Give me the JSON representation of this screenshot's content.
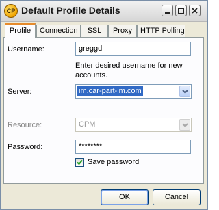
{
  "window": {
    "title": "Default Profile Details",
    "app_icon_text": "CP"
  },
  "tabs": [
    {
      "label": "Profile",
      "active": true
    },
    {
      "label": "Connection",
      "active": false
    },
    {
      "label": "SSL",
      "active": false
    },
    {
      "label": "Proxy",
      "active": false
    },
    {
      "label": "HTTP Polling",
      "active": false
    }
  ],
  "form": {
    "username_label": "Username:",
    "username_value": "greggd",
    "username_hint_line1": "Enter desired username for new",
    "username_hint_line2": "accounts.",
    "server_label": "Server:",
    "server_value": "im.car-part-im.com",
    "resource_label": "Resource:",
    "resource_value": "CPM",
    "password_label": "Password:",
    "password_value": "********",
    "save_password_label": "Save password",
    "save_password_checked": true
  },
  "buttons": {
    "ok": "OK",
    "cancel": "Cancel"
  },
  "colors": {
    "accent_tab": "#e68b2c",
    "selection": "#316ac5",
    "dialog_bg": "#ece9d8"
  }
}
